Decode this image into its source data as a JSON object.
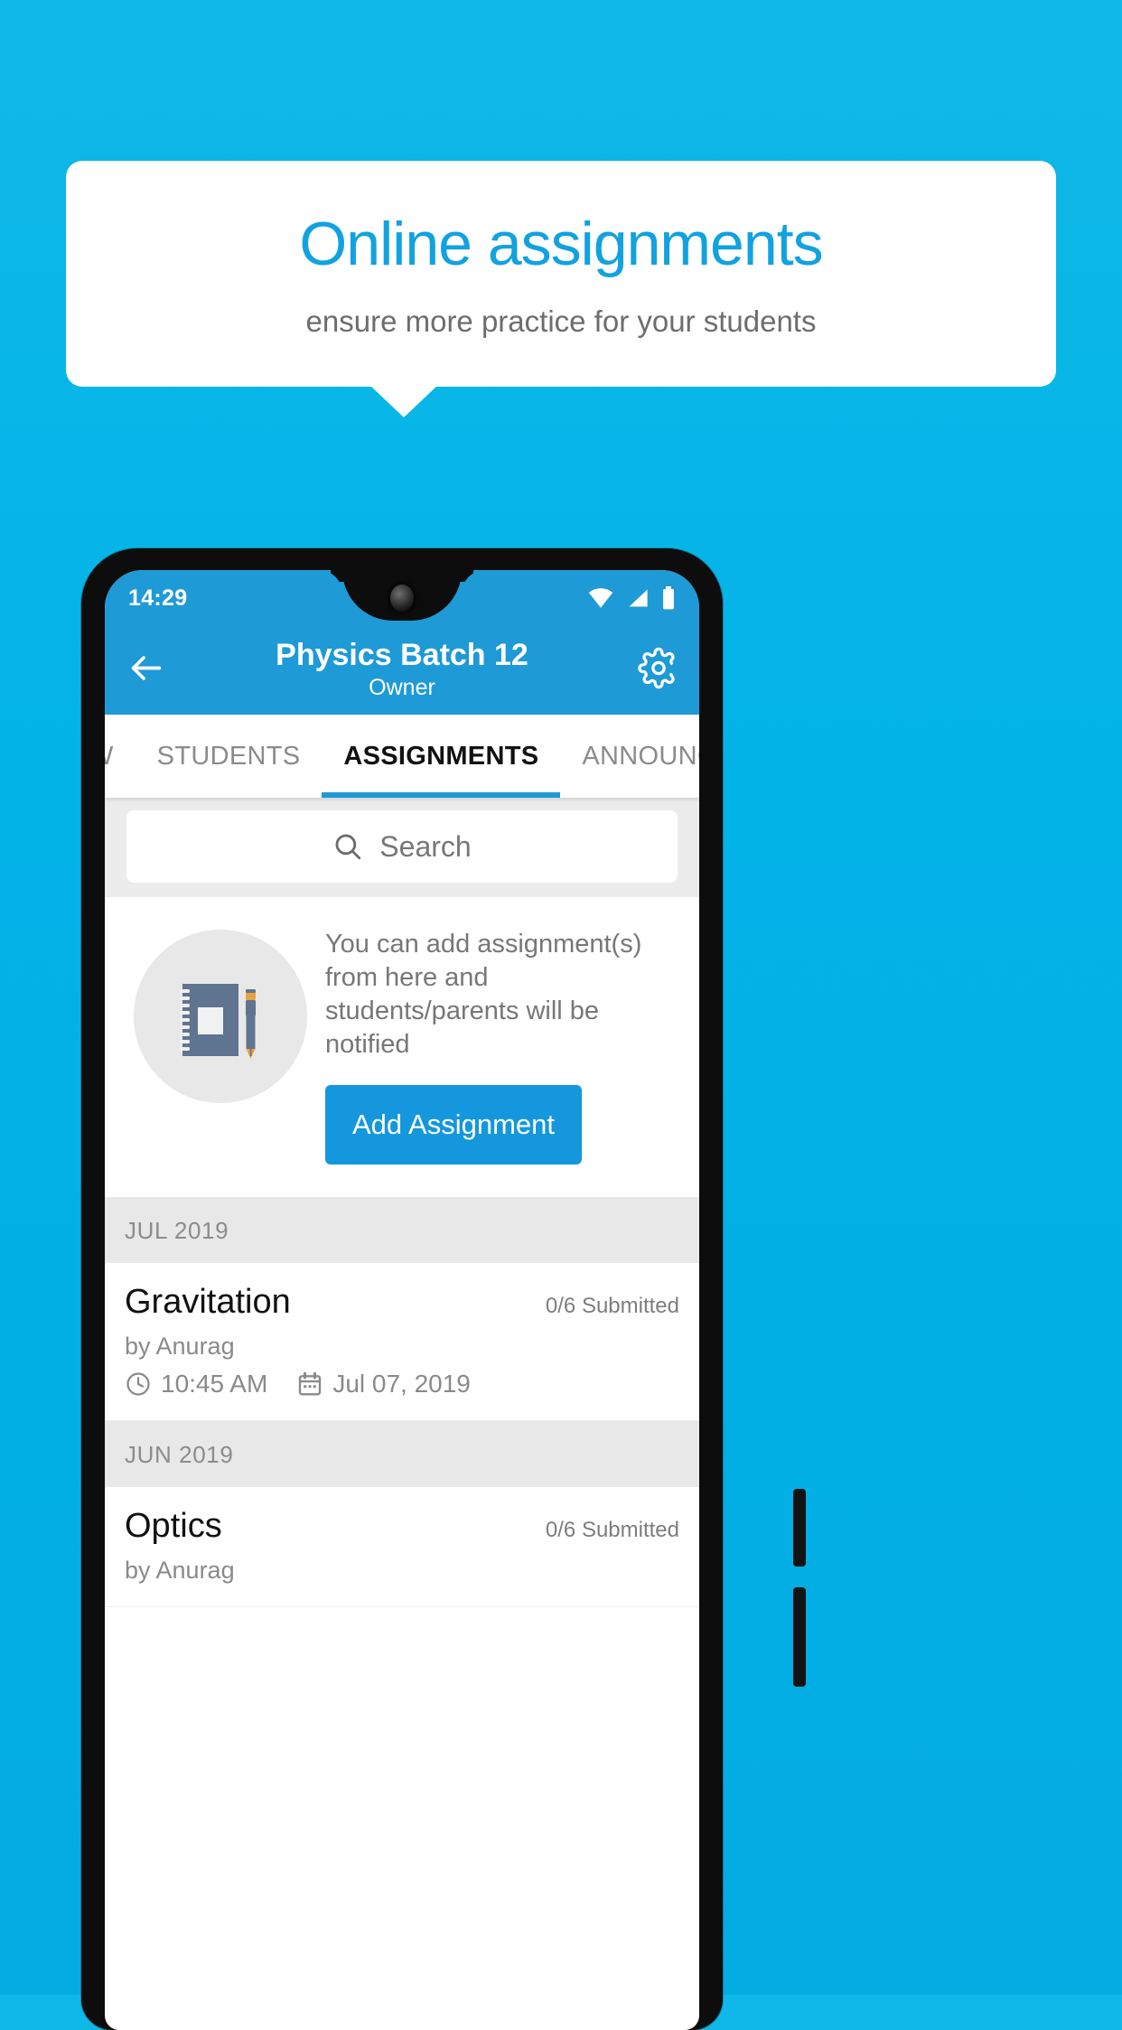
{
  "promo": {
    "title": "Online assignments",
    "subtitle": "ensure more practice for your students",
    "title_color": "#11a2e0",
    "subtitle_color": "#6d6d6d",
    "background_color": "#02b3e8"
  },
  "status_bar": {
    "time": "14:29",
    "icons": [
      "wifi-icon",
      "signal-icon",
      "battery-icon"
    ],
    "background_color": "#1e9ad6"
  },
  "app_bar": {
    "back_icon": "arrow-left-icon",
    "title": "Physics Batch 12",
    "subtitle": "Owner",
    "settings_icon": "gear-icon",
    "background_color": "#1e9ad6"
  },
  "tabs": {
    "items": [
      {
        "label": "IEW",
        "active": false
      },
      {
        "label": "STUDENTS",
        "active": false
      },
      {
        "label": "ASSIGNMENTS",
        "active": true
      },
      {
        "label": "ANNOUNCEM",
        "active": false
      }
    ],
    "indicator_color": "#1e9ad6"
  },
  "search": {
    "icon": "search-icon",
    "placeholder": "Search",
    "value": ""
  },
  "empty_state": {
    "illustration": "notebook-pen-icon",
    "message": "You can add assignment(s) from here and students/parents will be notified",
    "button_label": "Add Assignment",
    "button_color": "#1497dd"
  },
  "sections": [
    {
      "month": "JUL 2019",
      "rows": [
        {
          "title": "Gravitation",
          "submitted": "0/6 Submitted",
          "author": "by Anurag",
          "time_icon": "clock-icon",
          "time": "10:45 AM",
          "date_icon": "calendar-icon",
          "date": "Jul 07, 2019"
        }
      ]
    },
    {
      "month": "JUN 2019",
      "rows": [
        {
          "title": "Optics",
          "submitted": "0/6 Submitted",
          "author": "by Anurag",
          "time_icon": "clock-icon",
          "time": "",
          "date_icon": "calendar-icon",
          "date": ""
        }
      ]
    }
  ]
}
